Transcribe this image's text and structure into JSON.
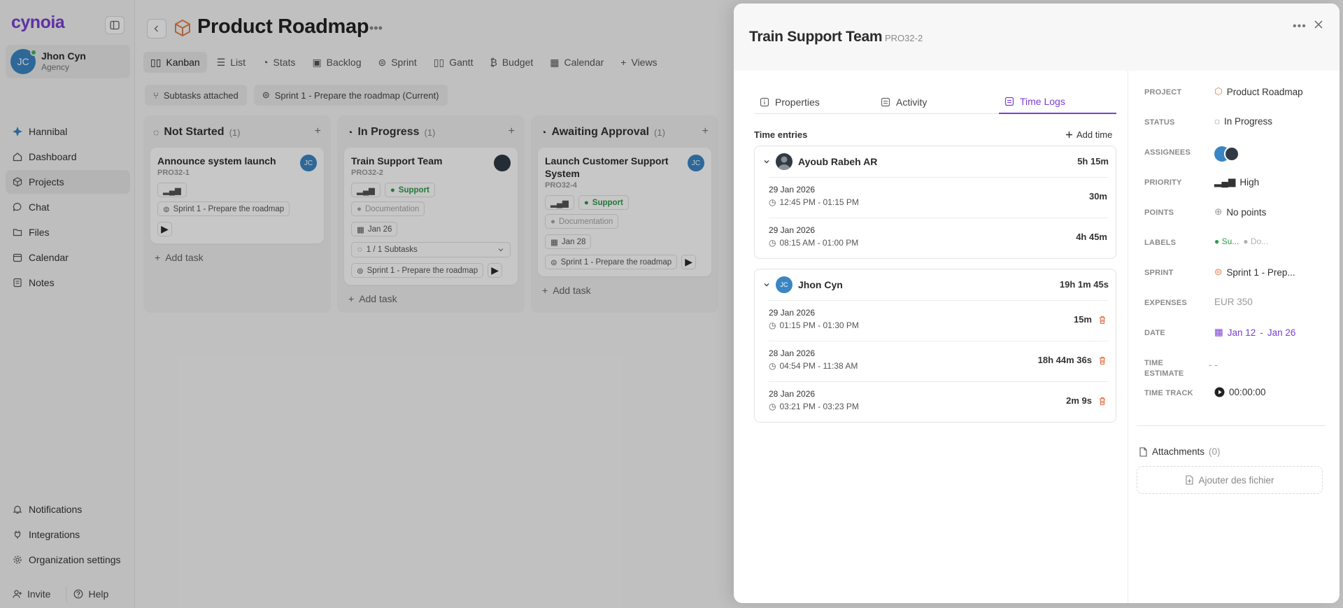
{
  "app": {
    "logo": "cynoia"
  },
  "user": {
    "initials": "JC",
    "name": "Jhon Cyn",
    "role": "Agency"
  },
  "sidebar": {
    "items": [
      {
        "label": "Hannibal",
        "icon": "diamond-icon"
      },
      {
        "label": "Dashboard",
        "icon": "home-icon"
      },
      {
        "label": "Projects",
        "icon": "cube-icon"
      },
      {
        "label": "Chat",
        "icon": "chat-icon"
      },
      {
        "label": "Files",
        "icon": "folder-icon"
      },
      {
        "label": "Calendar",
        "icon": "calendar-icon"
      },
      {
        "label": "Notes",
        "icon": "note-icon"
      }
    ],
    "bottom": [
      {
        "label": "Notifications",
        "icon": "bell-icon"
      },
      {
        "label": "Integrations",
        "icon": "plug-icon"
      },
      {
        "label": "Organization settings",
        "icon": "gear-icon"
      }
    ],
    "invite_label": "Invite",
    "help_label": "Help"
  },
  "project": {
    "title": "Product Roadmap",
    "tabs": [
      "Kanban",
      "List",
      "Stats",
      "Backlog",
      "Sprint",
      "Gantt",
      "Budget",
      "Calendar",
      "Views"
    ],
    "active_tab": "Kanban",
    "filters": [
      "Subtasks attached",
      "Sprint 1 - Prepare the roadmap (Current)"
    ]
  },
  "columns": [
    {
      "title": "Not Started",
      "count": "(1)",
      "cards": [
        {
          "title": "Announce system launch",
          "code": "PRO32-1",
          "assignee": "JC",
          "sprint": "Sprint 1 - Prepare the roadmap"
        }
      ],
      "add_label": "Add task"
    },
    {
      "title": "In Progress",
      "count": "(1)",
      "cards": [
        {
          "title": "Train Support Team",
          "code": "PRO32-2",
          "labels": [
            "Support",
            "Documentation"
          ],
          "date": "Jan 26",
          "subtasks": "1 / 1 Subtasks",
          "sprint": "Sprint 1 - Prepare the roadmap"
        }
      ],
      "add_label": "Add task"
    },
    {
      "title": "Awaiting Approval",
      "count": "(1)",
      "cards": [
        {
          "title": "Launch Customer Support System",
          "code": "PRO32-4",
          "assignee": "JC",
          "labels": [
            "Support",
            "Documentation"
          ],
          "date": "Jan 28",
          "sprint": "Sprint 1 - Prepare the roadmap"
        }
      ],
      "add_label": "Add task"
    }
  ],
  "panel": {
    "title": "Train Support Team",
    "code": "PRO32-2",
    "tabs": [
      "Properties",
      "Activity",
      "Time Logs"
    ],
    "active_tab": "Time Logs",
    "entries_title": "Time entries",
    "add_time_label": "Add time",
    "groups": [
      {
        "user": "Ayoub Rabeh AR",
        "total": "5h 15m",
        "entries": [
          {
            "date": "29 Jan 2026",
            "range": "12:45 PM - 01:15 PM",
            "duration": "30m"
          },
          {
            "date": "29 Jan 2026",
            "range": "08:15 AM - 01:00 PM",
            "duration": "4h 45m"
          }
        ]
      },
      {
        "user": "Jhon Cyn",
        "initials": "JC",
        "total": "19h 1m 45s",
        "entries": [
          {
            "date": "29 Jan 2026",
            "range": "01:15 PM - 01:30 PM",
            "duration": "15m"
          },
          {
            "date": "28 Jan 2026",
            "range": "04:54 PM - 11:38 AM",
            "duration": "18h 44m 36s"
          },
          {
            "date": "28 Jan 2026",
            "range": "03:21 PM - 03:23 PM",
            "duration": "2m 9s"
          }
        ]
      }
    ],
    "properties": {
      "project_label": "PROJECT",
      "project": "Product Roadmap",
      "status_label": "STATUS",
      "status": "In Progress",
      "assignees_label": "ASSIGNEES",
      "priority_label": "PRIORITY",
      "priority": "High",
      "points_label": "POINTS",
      "points": "No points",
      "labels_label": "LABELS",
      "label_a": "Su...",
      "label_b": "Do...",
      "sprint_label": "SPRINT",
      "sprint": "Sprint 1 - Prep...",
      "expenses_label": "EXPENSES",
      "expenses": "EUR 350",
      "date_label": "DATE",
      "date_start": "Jan 12",
      "date_sep": "-",
      "date_end": "Jan 26",
      "estimate_label_1": "TIME",
      "estimate_label_2": "ESTIMATE",
      "estimate": "- -",
      "track_label": "TIME TRACK",
      "track": "00:00:00"
    },
    "attachments_label": "Attachments",
    "attachments_count": "(0)",
    "upload_label": "Ajouter des fichier"
  },
  "colors": {
    "accent": "#7b3fd1",
    "support_green": "#2f9a4a",
    "avatar_blue": "#3a86c4",
    "delete_orange": "#e06a3b"
  }
}
